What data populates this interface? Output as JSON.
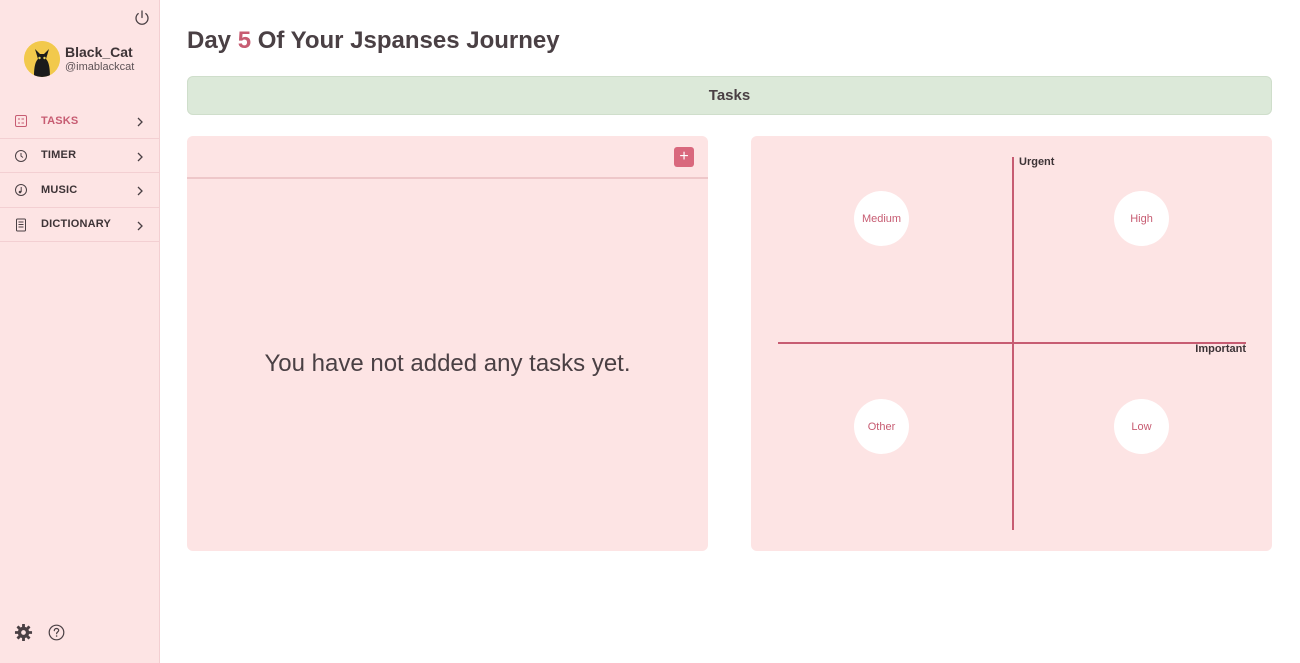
{
  "user": {
    "name": "Black_Cat",
    "handle": "@imablackcat"
  },
  "nav": {
    "items": [
      {
        "label": "TASKS",
        "icon": "tasks-icon",
        "active": true
      },
      {
        "label": "TIMER",
        "icon": "clock-icon",
        "active": false
      },
      {
        "label": "MUSIC",
        "icon": "music-icon",
        "active": false
      },
      {
        "label": "DICTIONARY",
        "icon": "dictionary-icon",
        "active": false
      }
    ]
  },
  "header": {
    "title_prefix": "Day ",
    "day_number": "5",
    "title_suffix": " Of Your Jspanses Journey"
  },
  "tasks_bar": {
    "label": "Tasks"
  },
  "task_panel": {
    "add_label": "+",
    "empty_message": "You have not added any tasks yet."
  },
  "matrix": {
    "y_axis_label": "Urgent",
    "x_axis_label": "Important",
    "quadrants": {
      "top_left": "Medium",
      "top_right": "High",
      "bottom_left": "Other",
      "bottom_right": "Low"
    }
  },
  "colors": {
    "accent": "#c75c72",
    "sidebar_bg": "#fde4e4",
    "tasks_bar_bg": "#dce9d9",
    "add_button": "#d9687d"
  }
}
